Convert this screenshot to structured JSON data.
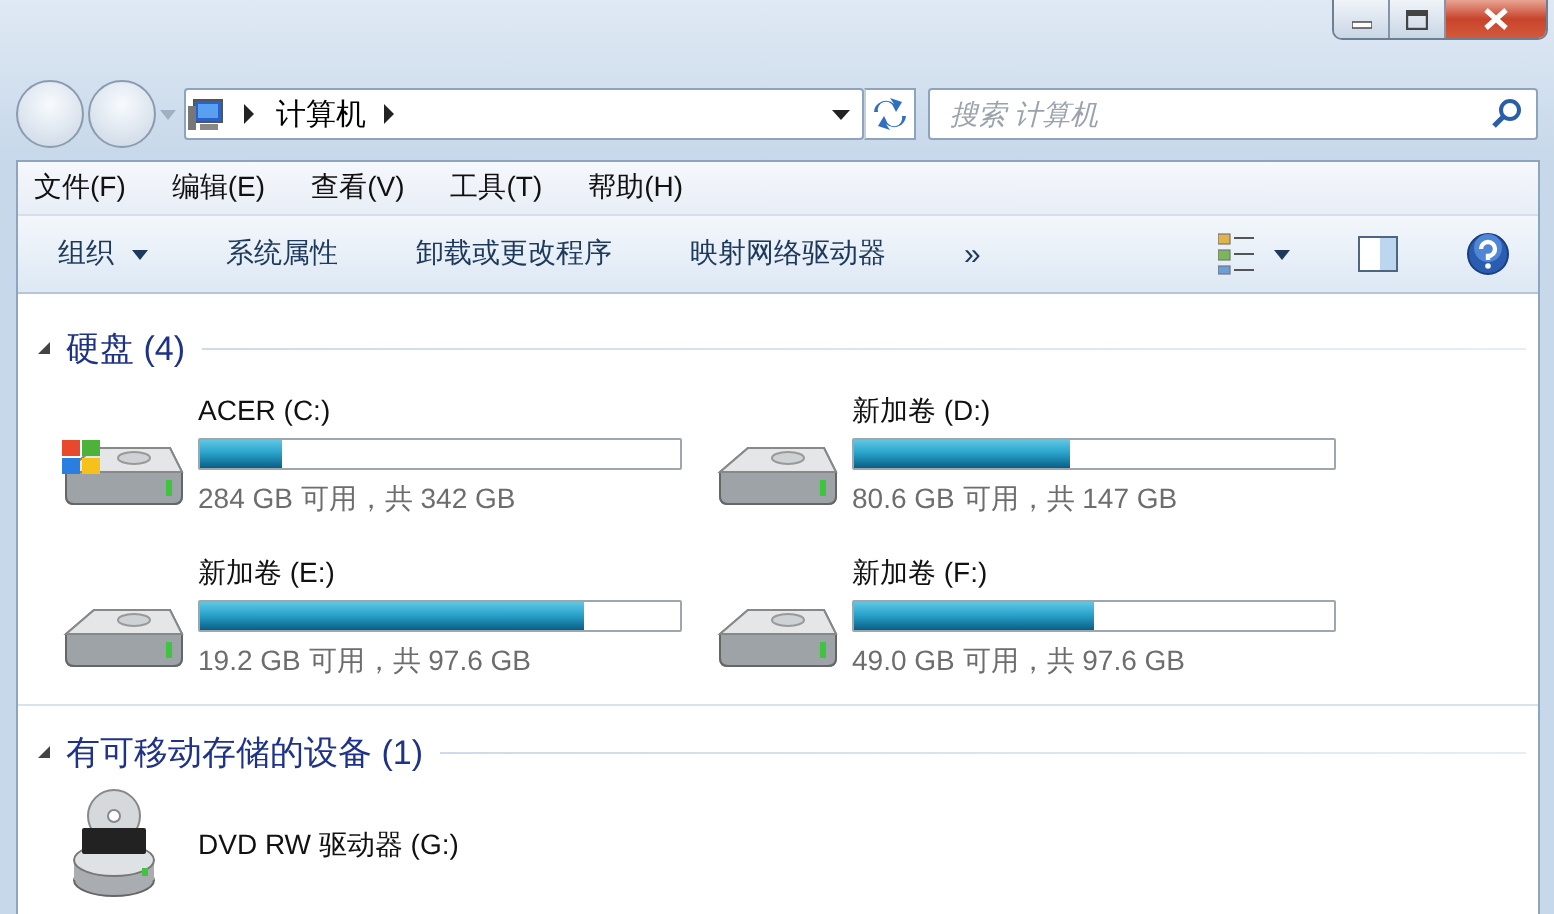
{
  "address": {
    "crumbs": [
      "计算机"
    ]
  },
  "search": {
    "placeholder": "搜索 计算机"
  },
  "menu": [
    "文件(F)",
    "编辑(E)",
    "查看(V)",
    "工具(T)",
    "帮助(H)"
  ],
  "toolbar": {
    "commands": [
      {
        "label": "组织",
        "dropdown": true
      },
      {
        "label": "系统属性",
        "dropdown": false
      },
      {
        "label": "卸载或更改程序",
        "dropdown": false
      },
      {
        "label": "映射网络驱动器",
        "dropdown": false
      }
    ],
    "more": "»"
  },
  "groups": [
    {
      "title": "硬盘 (4)",
      "expanded": true,
      "items": [
        {
          "name": "ACER (C:)",
          "kind": "system",
          "level": 0.17,
          "reading": "284 GB 可用，共 342 GB"
        },
        {
          "name": "新加卷 (D:)",
          "kind": "disk",
          "level": 0.45,
          "reading": "80.6 GB 可用，共 147 GB"
        },
        {
          "name": "新加卷 (E:)",
          "kind": "disk",
          "level": 0.8,
          "reading": "19.2 GB 可用，共 97.6 GB"
        },
        {
          "name": "新加卷 (F:)",
          "kind": "disk",
          "level": 0.5,
          "reading": "49.0 GB 可用，共 97.6 GB"
        }
      ]
    },
    {
      "title": "有可移动存储的设备 (1)",
      "expanded": true,
      "items": [
        {
          "name": "DVD RW 驱动器 (G:)",
          "kind": "optical"
        }
      ]
    }
  ]
}
